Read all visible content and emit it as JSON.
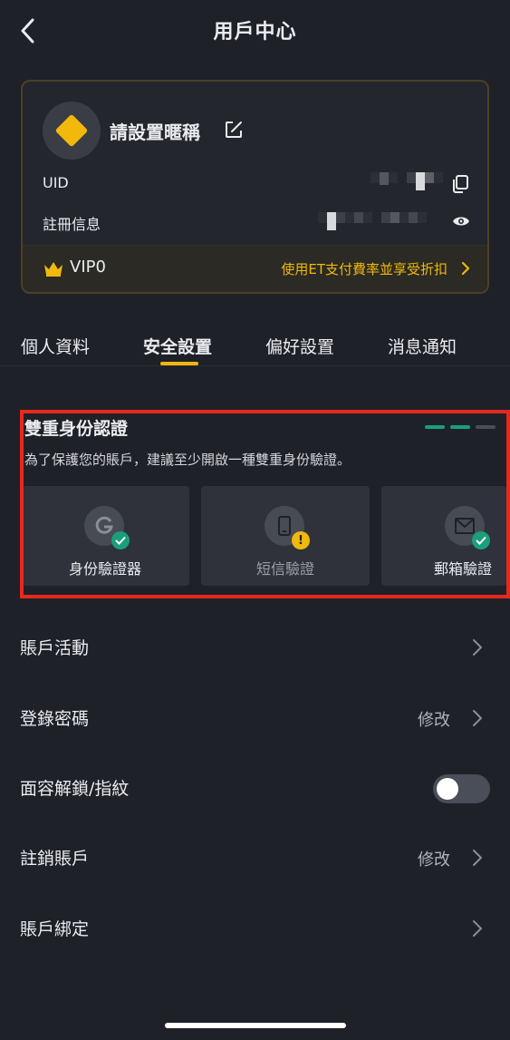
{
  "header": {
    "title": "用戶中心"
  },
  "profile": {
    "nickname": "請設置暱稱",
    "uid_label": "UID",
    "register_label": "註冊信息",
    "vip_level": "VIP0",
    "vip_promo": "使用ET支付費率並享受折扣"
  },
  "tabs": [
    {
      "label": "個人資料"
    },
    {
      "label": "安全設置"
    },
    {
      "label": "偏好設置"
    },
    {
      "label": "消息通知"
    }
  ],
  "active_tab": "安全設置",
  "twofa": {
    "title": "雙重身份認證",
    "description": "為了保護您的賬戶，建議至少開啟一種雙重身份驗證。",
    "strength_filled": 2,
    "strength_total": 3,
    "methods": [
      {
        "label": "身份驗證器",
        "icon": "google-g-icon",
        "status": "enabled"
      },
      {
        "label": "短信驗證",
        "icon": "phone-icon",
        "status": "warning"
      },
      {
        "label": "郵箱驗證",
        "icon": "mail-icon",
        "status": "enabled"
      }
    ]
  },
  "menu": {
    "account_activity": {
      "label": "賬戶活動"
    },
    "login_password": {
      "label": "登錄密碼",
      "action": "修改"
    },
    "face_unlock": {
      "label": "面容解鎖/指紋",
      "enabled": false
    },
    "delete_account": {
      "label": "註銷賬戶",
      "action": "修改"
    },
    "account_binding": {
      "label": "賬戶綁定"
    }
  },
  "colors": {
    "background": "#1f2129",
    "accent": "#f0b90b",
    "success": "#1a9f7b",
    "highlight_frame": "#e8281c"
  }
}
